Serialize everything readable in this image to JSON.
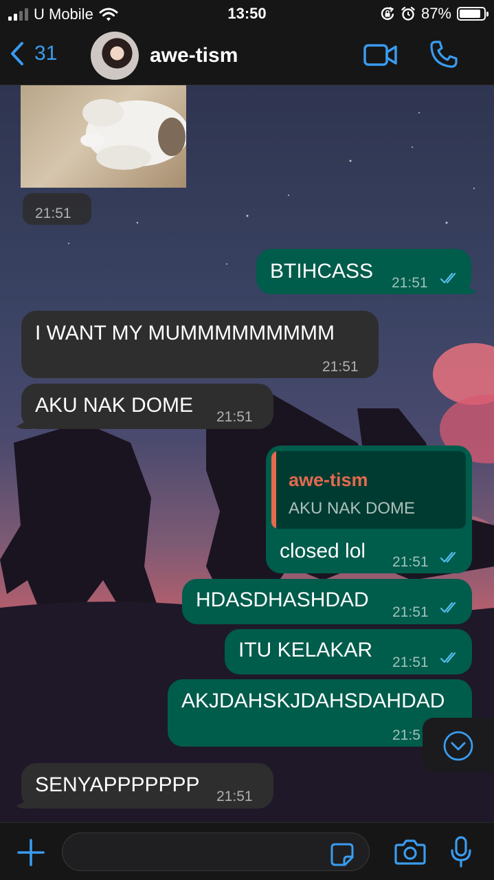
{
  "status_bar": {
    "carrier": "U Mobile",
    "time": "13:50",
    "battery_percent": "87%",
    "battery_level": 0.87,
    "icons": [
      "signal-icon",
      "wifi-icon",
      "rotation-lock-icon",
      "alarm-icon",
      "battery-icon"
    ]
  },
  "header": {
    "back_count": "31",
    "chat_name": "awe-tism",
    "icons": [
      "back-chevron-icon",
      "video-call-icon",
      "phone-icon"
    ]
  },
  "messages": [
    {
      "type": "image",
      "direction": "in",
      "time": "21:51"
    },
    {
      "type": "text",
      "direction": "out",
      "text": "BTIHCASS",
      "time": "21:51",
      "status": "read"
    },
    {
      "type": "text",
      "direction": "in",
      "text": "I WANT MY MUMMMMMMMMM",
      "time": "21:51"
    },
    {
      "type": "text",
      "direction": "in",
      "text": "AKU NAK DOME",
      "time": "21:51"
    },
    {
      "type": "reply",
      "direction": "out",
      "quote_author": "awe-tism",
      "quote_text": "AKU NAK DOME",
      "text": "closed lol",
      "time": "21:51",
      "status": "read"
    },
    {
      "type": "text",
      "direction": "out",
      "text": "HDASDHASHDAD",
      "time": "21:51",
      "status": "read"
    },
    {
      "type": "text",
      "direction": "out",
      "text": "ITU KELAKAR",
      "time": "21:51",
      "status": "read"
    },
    {
      "type": "text",
      "direction": "out",
      "text": "AKJDAHSKJDAHSDAHDAD",
      "time": "21:5",
      "status": "read"
    },
    {
      "type": "text",
      "direction": "in",
      "text": "SENYAPPPPPPP",
      "time": "21:51"
    }
  ],
  "input_bar": {
    "placeholder": "",
    "icons": [
      "plus-icon",
      "sticker-icon",
      "camera-icon",
      "microphone-icon"
    ]
  },
  "colors": {
    "accent": "#3a9cf0",
    "incoming_bubble": "#2e2e2f",
    "outgoing_bubble": "#005c4b",
    "quote_author": "#e46a4e",
    "read_ticks": "#53bdeb"
  }
}
